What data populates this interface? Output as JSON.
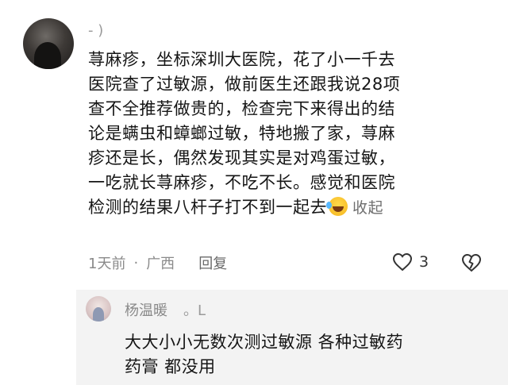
{
  "comment": {
    "username": "- )",
    "lines": [
      "荨麻疹，坐标深圳大医院，花了小一千去",
      "医院查了过敏源，做前医生还跟我说28项",
      "查不全推荐做贵的，检查完下来得出的结",
      "论是螨虫和蟑螂过敏，特地搬了家，荨麻",
      "疹还是长，偶然发现其实是对鸡蛋过敏，",
      "一吃就长荨麻疹，不吃不长。感觉和医院",
      "检测的结果八杆子打不到一起去"
    ],
    "emoji_icon": "rofl-emoji-icon",
    "collapse_label": "收起",
    "time": "1天前",
    "separator": "·",
    "location": "广西",
    "reply_label": "回复",
    "like_count": "3"
  },
  "reply": {
    "username": "杨温暖",
    "suffix": "。L",
    "lines": [
      "大大小小无数次测过敏源  各种过敏药",
      "药膏  都没用"
    ]
  }
}
